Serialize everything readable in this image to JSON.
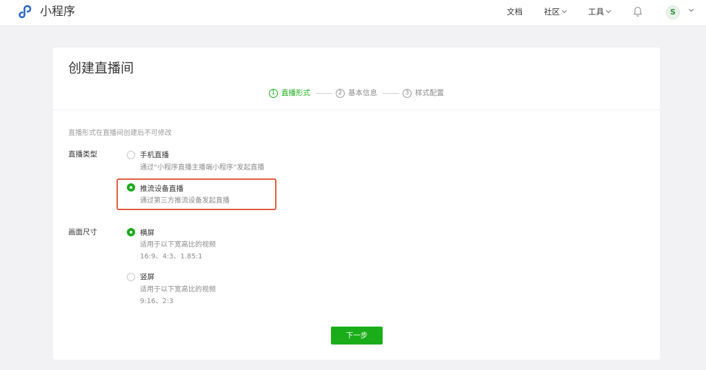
{
  "app": {
    "brand": "小程序"
  },
  "nav": {
    "docs": "文档",
    "community": "社区",
    "tools": "工具"
  },
  "colors": {
    "accent": "#1aad19",
    "highlight": "#e35b3e"
  },
  "card": {
    "title": "创建直播间",
    "steps": [
      {
        "num": "1",
        "label": "直播形式",
        "active": true
      },
      {
        "num": "2",
        "label": "基本信息",
        "active": false
      },
      {
        "num": "3",
        "label": "样式配置",
        "active": false
      }
    ],
    "hint": "直播形式在直播间创建后不可修改"
  },
  "live_type": {
    "label": "直播类型",
    "options": [
      {
        "title": "手机直播",
        "desc": "通过“小程序直播主播端小程序”发起直播",
        "checked": false
      },
      {
        "title": "推流设备直播",
        "desc": "通过第三方推流设备发起直播",
        "checked": true
      }
    ]
  },
  "screen_size": {
    "label": "画面尺寸",
    "options": [
      {
        "title": "横屏",
        "desc": "适用于以下宽高比的视频",
        "ratios": "16:9、4:3、1.85:1",
        "checked": true
      },
      {
        "title": "竖屏",
        "desc": "适用于以下宽高比的视频",
        "ratios": "9:16、2:3",
        "checked": false
      }
    ]
  },
  "actions": {
    "next": "下一步"
  },
  "icons": [
    "miniprogram-logo-icon",
    "bell-icon",
    "avatar",
    "chevron-down-icon"
  ]
}
